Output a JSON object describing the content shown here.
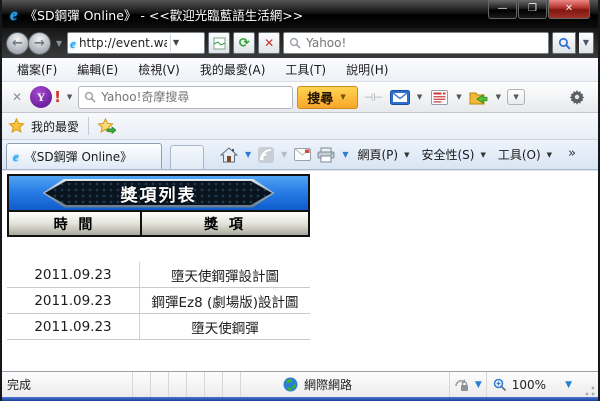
{
  "window": {
    "title": "《SD鋼彈 Online》 - <<歡迎光臨藍語生活網>>"
  },
  "nav": {
    "address": "http://event.wa...",
    "search_placeholder": "Yahoo!"
  },
  "menu": {
    "items": [
      "檔案(F)",
      "編輯(E)",
      "檢視(V)",
      "我的最愛(A)",
      "工具(T)",
      "說明(H)"
    ]
  },
  "yahoo_toolbar": {
    "logo": "Y",
    "logo_bang": "!",
    "close_glyph": "✕",
    "search_placeholder": "Yahoo!奇摩搜尋",
    "search_button": "搜尋"
  },
  "favorites_bar": {
    "label": "我的最愛"
  },
  "tab": {
    "label": "《SD鋼彈 Online》"
  },
  "command_bar": {
    "page_menu": "網頁(P)",
    "safety_menu": "安全性(S)",
    "tools_menu": "工具(O)",
    "overflow": "»"
  },
  "page": {
    "banner_title": "獎項列表",
    "table": {
      "headers": {
        "time": "時 間",
        "award": "獎 項"
      },
      "rows": [
        {
          "time": "2011.09.23",
          "award": "墮天使鋼彈設計圖"
        },
        {
          "time": "2011.09.23",
          "award": "鋼彈Ez8 (劇場版)設計圖"
        },
        {
          "time": "2011.09.23",
          "award": "墮天使鋼彈"
        }
      ]
    }
  },
  "status_bar": {
    "status": "完成",
    "zone": "網際網路",
    "zoom_level": "100%"
  },
  "icons": {
    "dropdown": "▼",
    "back_arrow": "←",
    "forward_arrow": "→",
    "stop_glyph": "✕",
    "refresh_glyph": "⟳",
    "min_glyph": "—",
    "max_glyph": "❐",
    "close_glyph": "✕",
    "ie_glyph": "e"
  },
  "colors": {
    "banner_blue": "#1565d8",
    "badge_dark": "#0a141f",
    "search_button_orange": "#f8a62a",
    "close_red": "#b03028",
    "window_bottom_blue": "#1d3e96"
  }
}
